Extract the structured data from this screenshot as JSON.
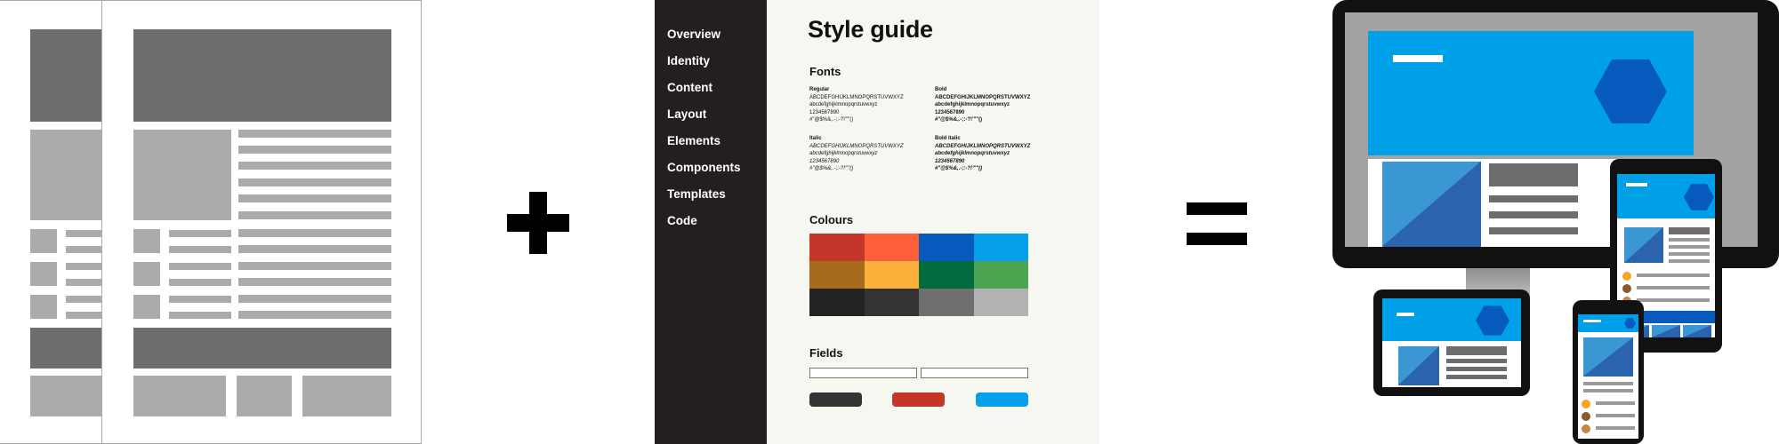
{
  "operators": {
    "plus": "+",
    "equals": "="
  },
  "style_guide": {
    "nav_items": [
      "Overview",
      "Identity",
      "Content",
      "Layout",
      "Elements",
      "Components",
      "Templates",
      "Code"
    ],
    "title": "Style guide",
    "fonts_heading": "Fonts",
    "font_samples": [
      {
        "label": "Regular",
        "upper": "ABCDEFGHIJKLMNOPQRSTUVWXYZ",
        "lower": "abcdefghijklmnopqrstuvwxyz",
        "digits": "1234567890",
        "symbols": "#\"@$%&,.-;:-?!'\"\"()"
      },
      {
        "label": "Bold",
        "upper": "ABCDEFGHIJKLMNOPQRSTUVWXYZ",
        "lower": "abcdefghijklmnopqrstuvwxyz",
        "digits": "1234567890",
        "symbols": "#\"@$%&,.-;:-?!'\"\"()"
      },
      {
        "label": "Italic",
        "upper": "ABCDEFGHIJKLMNOPQRSTUVWXYZ",
        "lower": "abcdefghijklmnopqrstuvwxyz",
        "digits": "1234567890",
        "symbols": "#\"@$%&,.-;:-?!'\"\"()"
      },
      {
        "label": "Bold italic",
        "upper": "ABCDEFGHIJKLMNOPQRSTUVWXYZ",
        "lower": "abcdefghijklmnopqrstuvwxyz",
        "digits": "1234567890",
        "symbols": "#\"@$%&,.-;:-?!'\"\"()"
      }
    ],
    "colours_heading": "Colours",
    "swatches": [
      "#c4352a",
      "#fd5e3b",
      "#0659bd",
      "#069fea",
      "#a76b1e",
      "#fcb23a",
      "#006b3d",
      "#4ba552",
      "#222222",
      "#333333",
      "#6f6f6f",
      "#b2b2b2"
    ],
    "fields_heading": "Fields",
    "button_colors": [
      "#333333",
      "#c4352a",
      "#069fea"
    ]
  },
  "colors": {
    "wire_dark": "#6d6d6d",
    "wire_light": "#ababab",
    "brand_blue": "#00a0e9",
    "hexagon": "#0659bd"
  }
}
